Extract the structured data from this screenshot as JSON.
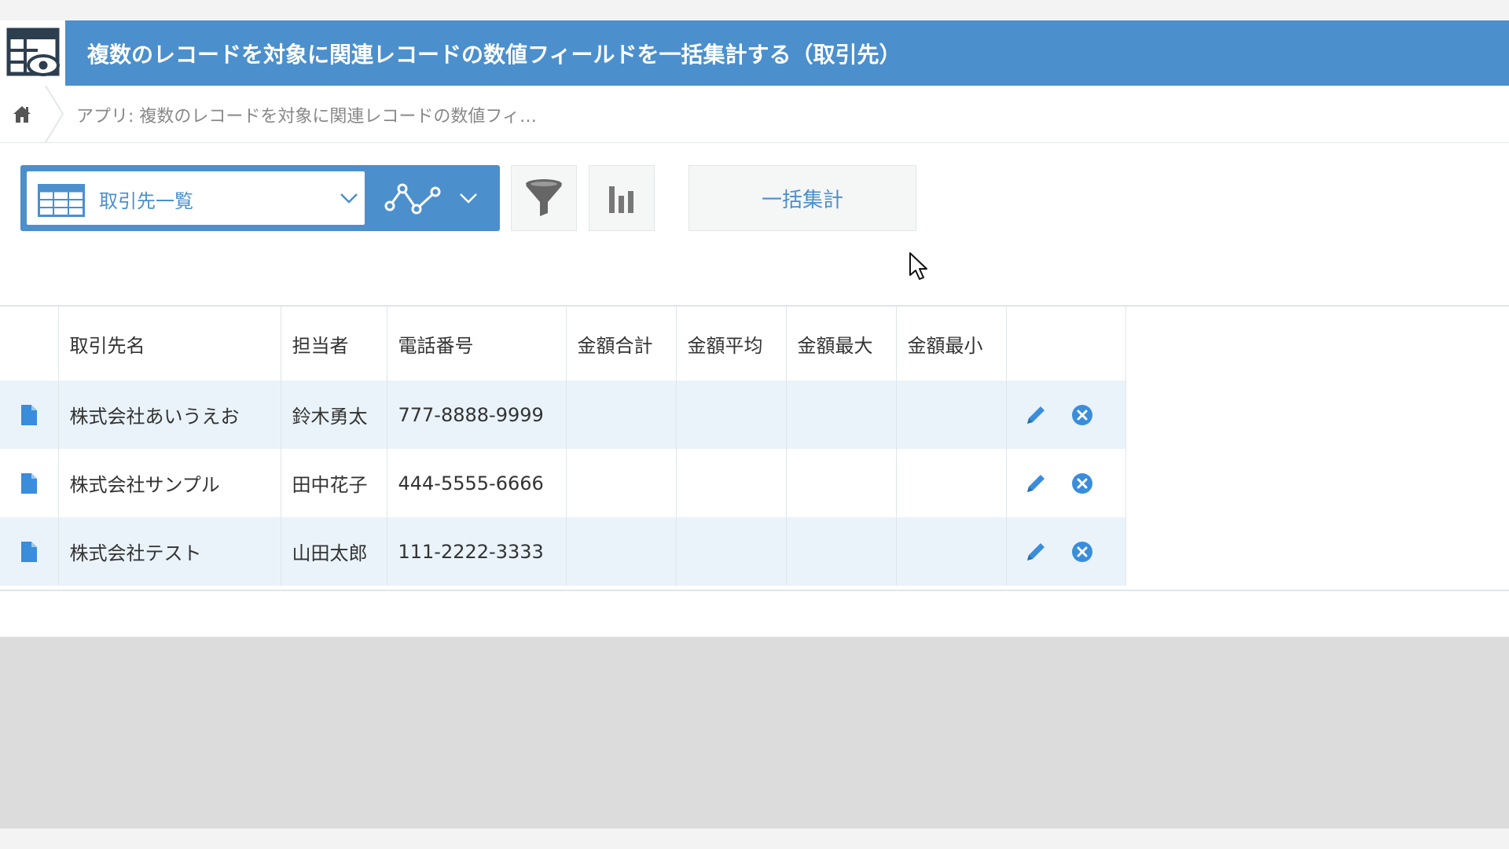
{
  "app": {
    "title": "複数のレコードを対象に関連レコードの数値フィールドを一括集計する（取引先）",
    "header_color": "#4b8fcd",
    "icon": "table-eye-icon"
  },
  "breadcrumb": {
    "home_icon": "home-icon",
    "text": "アプリ: 複数のレコードを対象に関連レコードの数値フィ…"
  },
  "toolbar": {
    "view_name": "取引先一覧",
    "view_icon": "list-view-icon",
    "graph_icon": "graph-icon",
    "filter_icon": "filter-icon",
    "chart_icon": "bar-chart-icon",
    "bulk_button_label": "一括集計"
  },
  "table": {
    "columns": [
      "取引先名",
      "担当者",
      "電話番号",
      "金額合計",
      "金額平均",
      "金額最大",
      "金額最小"
    ],
    "rows": [
      {
        "company": "株式会社あいうえお",
        "person": "鈴木勇太",
        "phone": "777-8888-9999",
        "sum": "",
        "avg": "",
        "max": "",
        "min": ""
      },
      {
        "company": "株式会社サンプル",
        "person": "田中花子",
        "phone": "444-5555-6666",
        "sum": "",
        "avg": "",
        "max": "",
        "min": ""
      },
      {
        "company": "株式会社テスト",
        "person": "山田太郎",
        "phone": "111-2222-3333",
        "sum": "",
        "avg": "",
        "max": "",
        "min": ""
      }
    ],
    "row_icons": {
      "detail": "document-icon",
      "edit": "pencil-icon",
      "delete": "close-circle-icon"
    },
    "stripe_color": "#eaf3fa"
  }
}
